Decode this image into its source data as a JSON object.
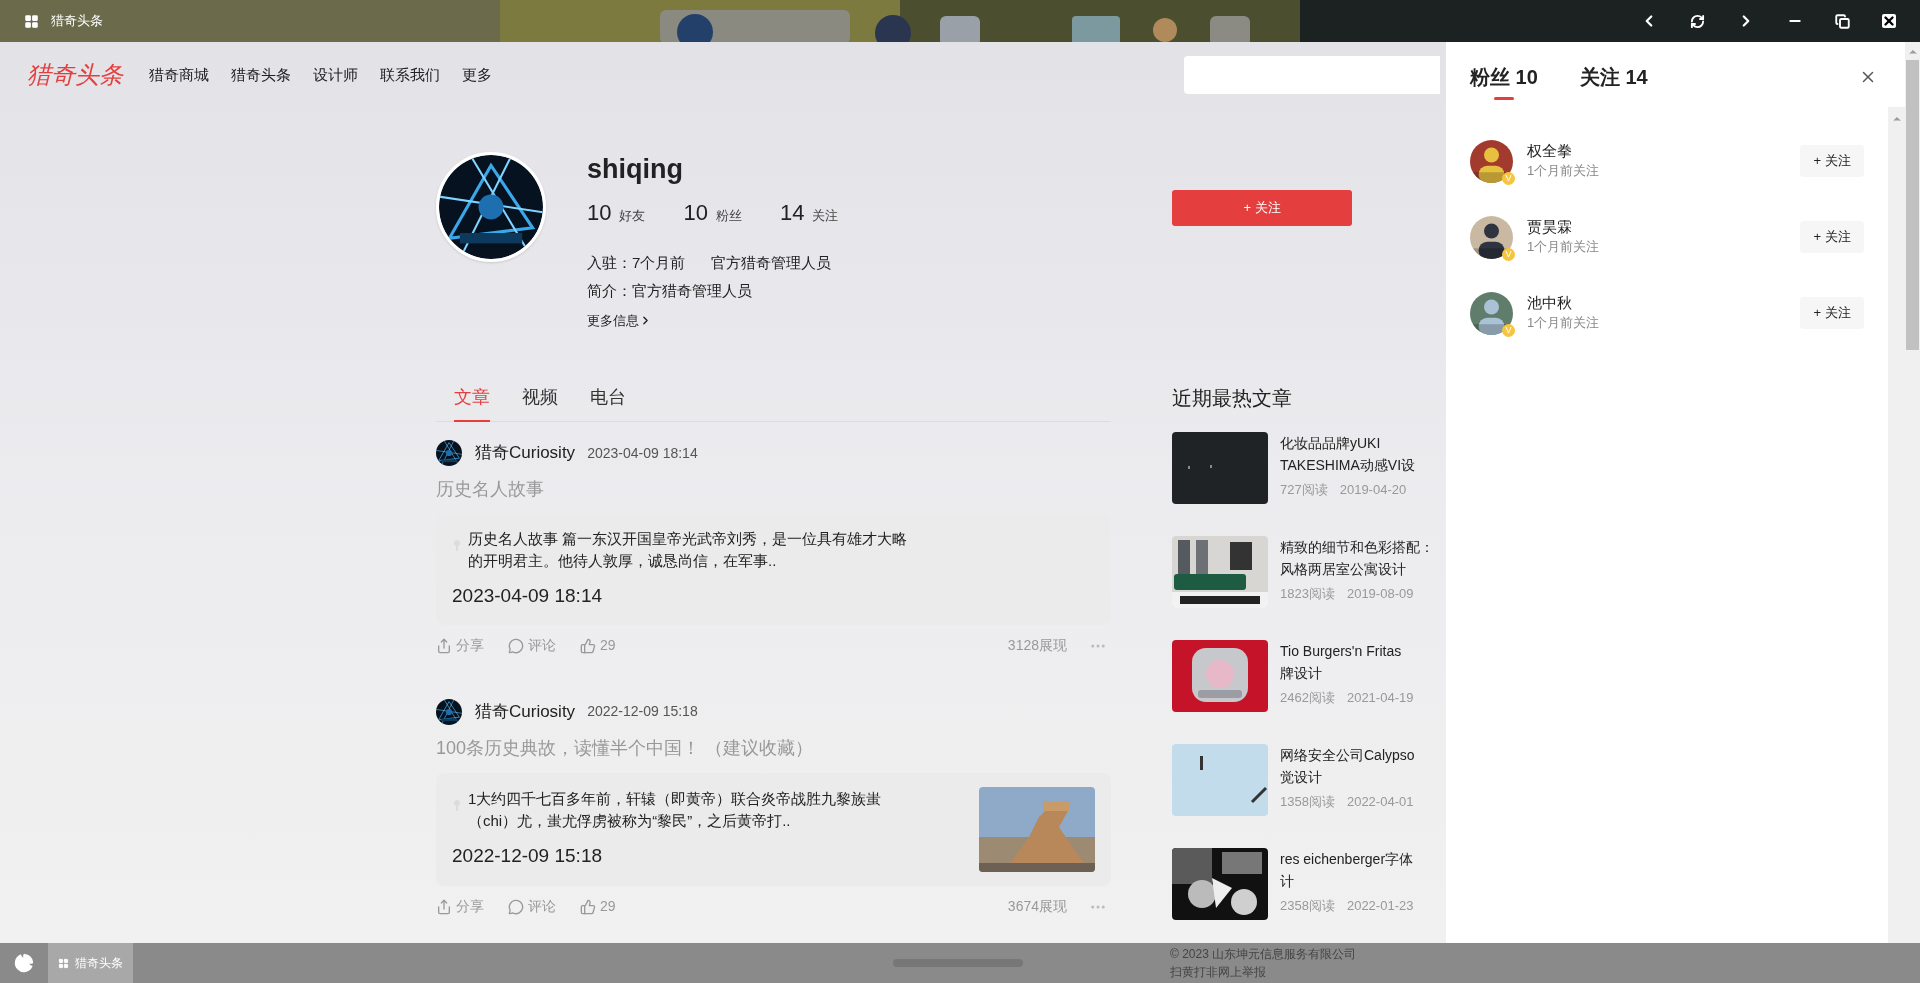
{
  "window": {
    "title": "猎奇头条"
  },
  "nav": {
    "logo": "猎奇头条",
    "items": [
      "猎奇商城",
      "猎奇头条",
      "设计师",
      "联系我们",
      "更多"
    ]
  },
  "profile": {
    "name": "shiqing",
    "stats": [
      {
        "value": "10",
        "label": "好友"
      },
      {
        "value": "10",
        "label": "粉丝"
      },
      {
        "value": "14",
        "label": "关注"
      }
    ],
    "joined": "入驻：7个月前",
    "role": "官方猎奇管理人员",
    "bio": "简介：官方猎奇管理人员",
    "more": "更多信息",
    "follow_button": "+ 关注"
  },
  "tabs": [
    {
      "label": "文章",
      "selected": true
    },
    {
      "label": "视频",
      "selected": false
    },
    {
      "label": "电台",
      "selected": false
    }
  ],
  "articles": [
    {
      "author": "猎奇Curiosity",
      "time": "2023-04-09 18:14",
      "title": "历史名人故事",
      "summary": "历史名人故事 篇一东汉开国皇帝光武帝刘秀，是一位具有雄才大略的开明君主。他待人敦厚，诚恳尚信，在军事..",
      "date": "2023-04-09 18:14",
      "share": "分享",
      "comment": "评论",
      "likes": "29",
      "views": "3128展现"
    },
    {
      "author": "猎奇Curiosity",
      "time": "2022-12-09 15:18",
      "title": "100条历史典故，读懂半个中国！ （建议收藏）",
      "summary": "1大约四千七百多年前，轩辕（即黄帝）联合炎帝战胜九黎族蚩（chi）尤，蚩尤俘虏被称为“黎民”，之后黄帝打..",
      "date": "2022-12-09 15:18",
      "share": "分享",
      "comment": "评论",
      "likes": "29",
      "views": "3674展现"
    }
  ],
  "hot": {
    "title": "近期最热文章",
    "items": [
      {
        "lines": [
          "化妆品品牌yUKI",
          "TAKESHIMA动感VI设"
        ],
        "reads": "727阅读",
        "date": "2019-04-20"
      },
      {
        "lines": [
          "精致的细节和色彩搭配：",
          "风格两居室公寓设计"
        ],
        "reads": "1823阅读",
        "date": "2019-08-09"
      },
      {
        "lines": [
          "Tio Burgers'n Fritas",
          "牌设计"
        ],
        "reads": "2462阅读",
        "date": "2021-04-19"
      },
      {
        "lines": [
          "网络安全公司Calypso",
          "觉设计"
        ],
        "reads": "1358阅读",
        "date": "2022-04-01"
      },
      {
        "lines": [
          "res eichenberger字体",
          "计"
        ],
        "reads": "2358阅读",
        "date": "2022-01-23"
      }
    ]
  },
  "footer": {
    "copyright": "© 2023 山东坤元信息服务有限公司",
    "report": "扫黄打非网上举报"
  },
  "panel": {
    "tabs": [
      {
        "label": "粉丝",
        "count": "10",
        "selected": true
      },
      {
        "label": "关注",
        "count": "14",
        "selected": false
      }
    ],
    "users": [
      {
        "name": "权全拳",
        "time": "1个月前关注",
        "badge": "V",
        "button": "+ 关注"
      },
      {
        "name": "贾昊霖",
        "time": "1个月前关注",
        "badge": "V",
        "button": "+ 关注"
      },
      {
        "name": "池中秋",
        "time": "1个月前关注",
        "badge": "V",
        "button": "+ 关注"
      }
    ]
  },
  "taskbar": {
    "apps": [
      {
        "label": "猎奇头条",
        "selected": true
      }
    ]
  }
}
